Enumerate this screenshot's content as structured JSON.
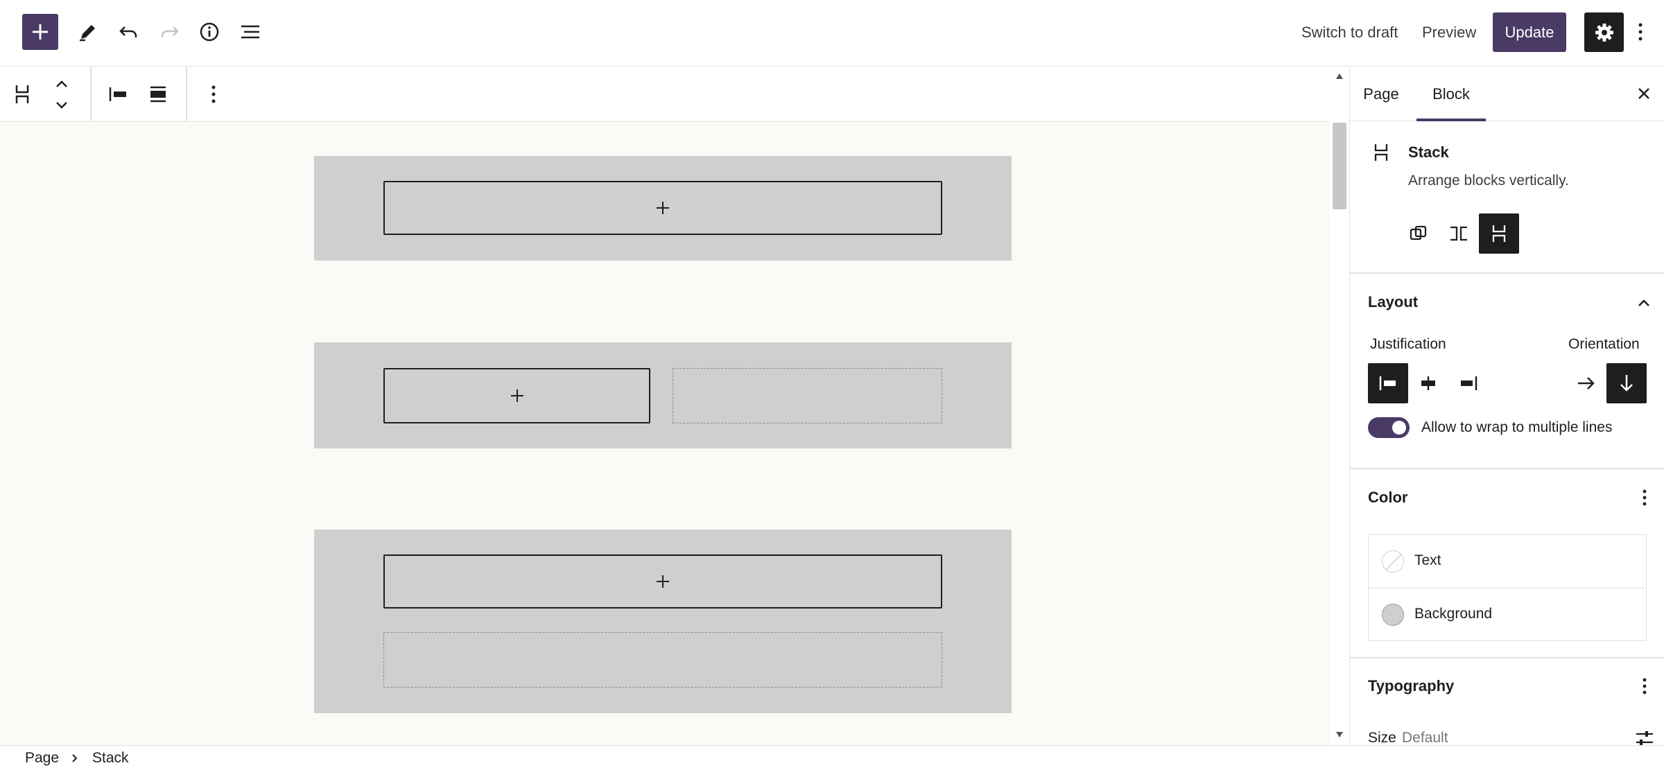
{
  "header": {
    "switch_to_draft": "Switch to draft",
    "preview": "Preview",
    "update": "Update",
    "icons": [
      "plus-icon",
      "pencil-icon",
      "undo-icon",
      "redo-icon",
      "info-icon",
      "list-view-icon",
      "gear-icon",
      "more-vertical-icon"
    ]
  },
  "toolbar": {
    "icons": [
      "stack-icon",
      "move-up-icon",
      "move-down-icon",
      "justify-left-icon",
      "align-icon",
      "more-vertical-icon"
    ]
  },
  "sidebar": {
    "tabs": [
      {
        "label": "Page",
        "active": false
      },
      {
        "label": "Block",
        "active": true
      }
    ],
    "block": {
      "name": "Stack",
      "description": "Arrange blocks vertically."
    },
    "layout": {
      "title": "Layout",
      "justification_label": "Justification",
      "orientation_label": "Orientation",
      "wrap_label": "Allow to wrap to multiple lines",
      "wrap_enabled": true
    },
    "color": {
      "title": "Color",
      "items": [
        {
          "label": "Text",
          "swatch": "none"
        },
        {
          "label": "Background",
          "swatch": "#cfcfcf"
        }
      ]
    },
    "typography": {
      "title": "Typography",
      "size_label": "Size",
      "size_value": "Default"
    }
  },
  "breadcrumb": {
    "items": [
      "Page",
      "Stack"
    ]
  },
  "colors": {
    "accent": "#4a3a66",
    "dark": "#1e1e1e",
    "group_bg": "#cfcfcf",
    "canvas_bg": "#fbfaf7"
  }
}
